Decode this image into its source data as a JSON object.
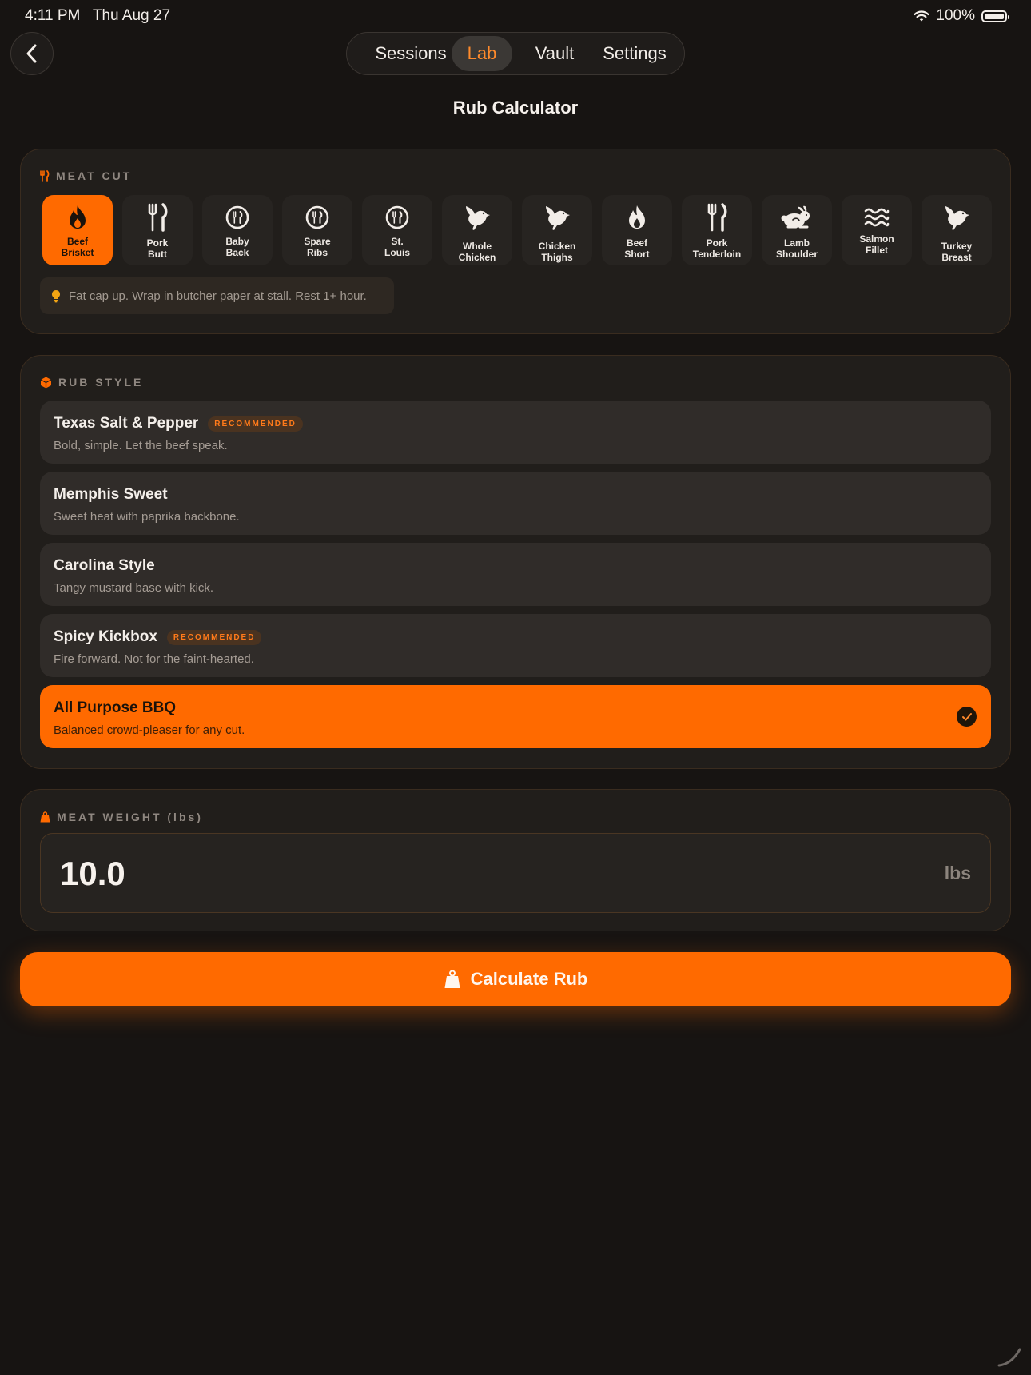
{
  "status": {
    "time": "4:11 PM   Thu Aug 27",
    "battery": "100%"
  },
  "nav": {
    "tabs": [
      {
        "label": "Sessions"
      },
      {
        "label": "Lab",
        "active": true
      },
      {
        "label": "Vault"
      },
      {
        "label": "Settings"
      }
    ]
  },
  "page": {
    "title": "Rub Calculator"
  },
  "meat_cut": {
    "title": "MEAT CUT",
    "items": [
      {
        "label": "Beef\nBrisket",
        "icon": "flame-icon",
        "selected": true
      },
      {
        "label": "Pork\nButt",
        "icon": "fork-knife-icon"
      },
      {
        "label": "Baby\nBack",
        "icon": "plate-utensils-icon"
      },
      {
        "label": "Spare\nRibs",
        "icon": "plate-utensils-icon"
      },
      {
        "label": "St.\nLouis",
        "icon": "plate-utensils-icon"
      },
      {
        "label": "Whole\nChicken",
        "icon": "bird-icon"
      },
      {
        "label": "Chicken\nThighs",
        "icon": "bird-icon"
      },
      {
        "label": "Beef\nShort",
        "icon": "flame-icon"
      },
      {
        "label": "Pork\nTenderloin",
        "icon": "fork-knife-icon"
      },
      {
        "label": "Lamb\nShoulder",
        "icon": "rabbit-icon"
      },
      {
        "label": "Salmon\nFillet",
        "icon": "waves-icon"
      },
      {
        "label": "Turkey\nBreast",
        "icon": "bird-icon"
      }
    ],
    "tip": "Fat cap up. Wrap in butcher paper at stall. Rest 1+ hour."
  },
  "rub_style": {
    "title": "RUB STYLE",
    "items": [
      {
        "name": "Texas Salt & Pepper",
        "desc": "Bold, simple. Let the beef speak.",
        "badge": "RECOMMENDED"
      },
      {
        "name": "Memphis Sweet",
        "desc": "Sweet heat with paprika backbone."
      },
      {
        "name": "Carolina Style",
        "desc": "Tangy mustard base with kick."
      },
      {
        "name": "Spicy Kickbox",
        "desc": "Fire forward. Not for the faint-hearted.",
        "badge": "RECOMMENDED"
      },
      {
        "name": "All Purpose BBQ",
        "desc": "Balanced crowd-pleaser for any cut.",
        "selected": true
      }
    ]
  },
  "weight": {
    "title": "MEAT WEIGHT (lbs)",
    "value": "10.0",
    "unit": "lbs"
  },
  "action": {
    "label": "Calculate Rub"
  },
  "colors": {
    "accent": "#ff6a00",
    "background": "#171412",
    "card": "#211e1b"
  }
}
